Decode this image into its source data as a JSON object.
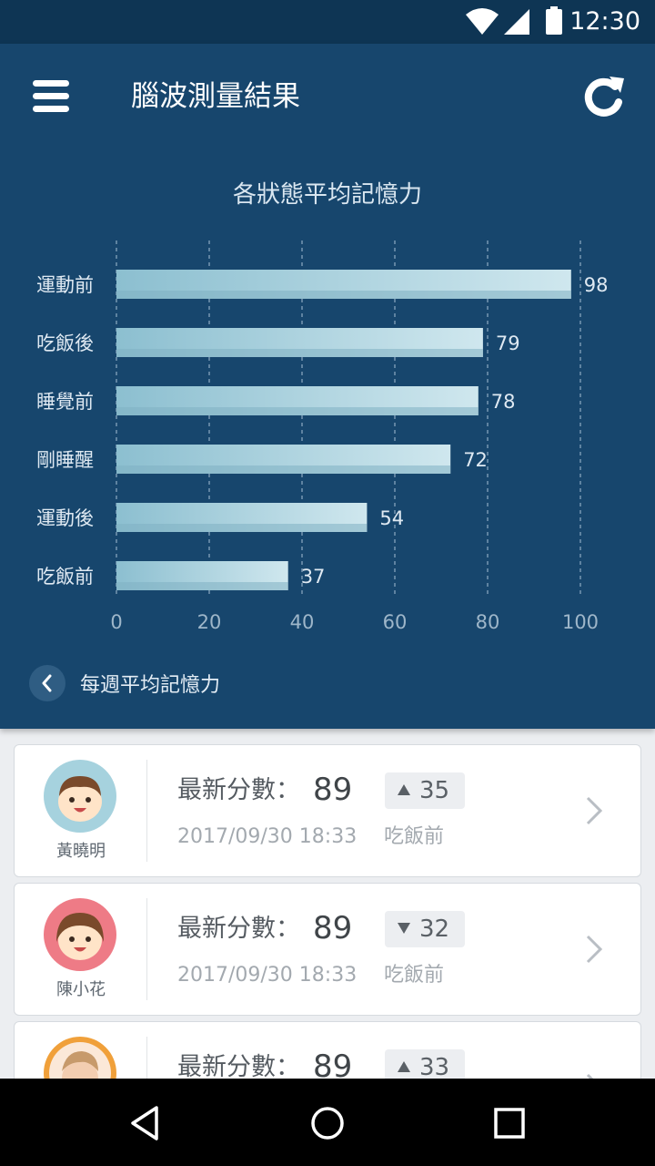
{
  "status_bar": {
    "time": "12:30",
    "icons": [
      "wifi-icon",
      "signal-icon",
      "battery-icon"
    ]
  },
  "header": {
    "title": "腦波測量結果",
    "menu_icon": "menu-icon",
    "refresh_icon": "refresh-icon"
  },
  "chart_data": {
    "type": "bar",
    "orientation": "horizontal",
    "title": "各狀態平均記憶力",
    "categories": [
      "運動前",
      "吃飯後",
      "睡覺前",
      "剛睡醒",
      "運動後",
      "吃飯前"
    ],
    "values": [
      98,
      79,
      78,
      72,
      54,
      37
    ],
    "xlim": [
      0,
      100
    ],
    "xticks": [
      0,
      20,
      40,
      60,
      80,
      100
    ],
    "grid": true,
    "xlabel": "",
    "ylabel": ""
  },
  "weekly_link": {
    "label": "每週平均記憶力",
    "icon": "chevron-left-icon"
  },
  "records": [
    {
      "name": "黃曉明",
      "score_label": "最新分數：",
      "score": "89",
      "trend": "up",
      "delta": "35",
      "timestamp": "2017/09/30 18:33",
      "state": "吃飯前",
      "avatar_color": "#a6d2de"
    },
    {
      "name": "陳小花",
      "score_label": "最新分數：",
      "score": "89",
      "trend": "down",
      "delta": "32",
      "timestamp": "2017/09/30 18:33",
      "state": "吃飯前",
      "avatar_color": "#ee7b86"
    },
    {
      "name": "",
      "score_label": "最新分數：",
      "score": "89",
      "trend": "up",
      "delta": "33",
      "timestamp": "",
      "state": "",
      "avatar_color": "#f0a03a"
    }
  ],
  "nav_bar": {
    "icons": [
      "back-triangle-icon",
      "home-circle-icon",
      "recents-square-icon"
    ]
  }
}
